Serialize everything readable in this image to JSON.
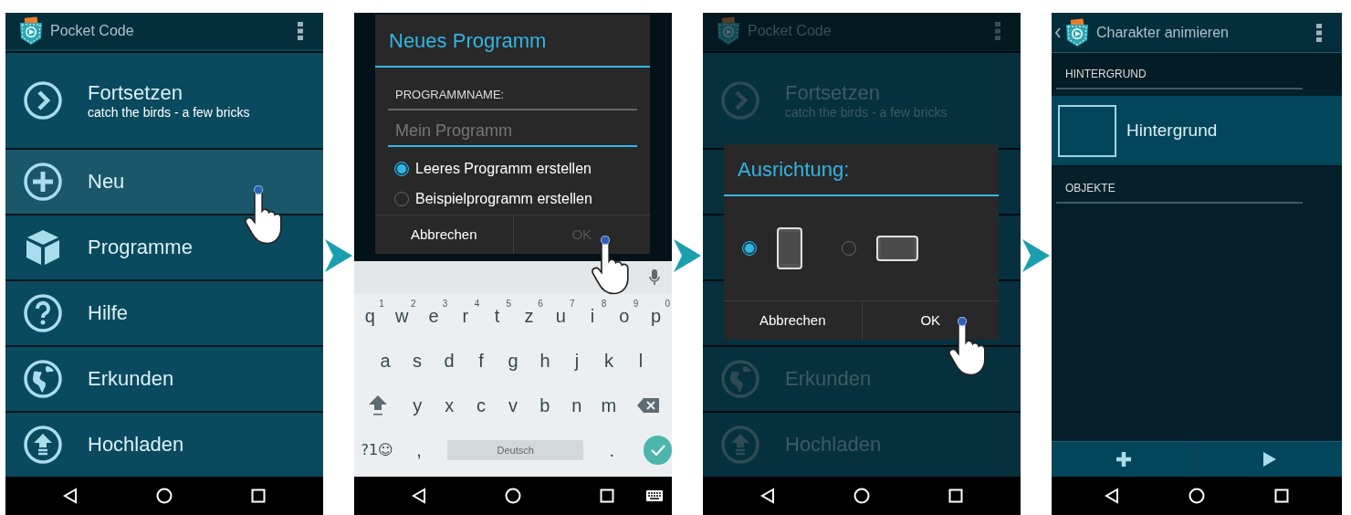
{
  "menu_screen": {
    "title": "Pocket Code",
    "items": [
      {
        "kind": "continue",
        "label": "Fortsetzen",
        "subtitle": "catch the birds - a few bricks",
        "pressed": false
      },
      {
        "kind": "new",
        "label": "Neu",
        "pressed": true
      },
      {
        "kind": "programs",
        "label": "Programme",
        "pressed": false
      },
      {
        "kind": "help",
        "label": "Hilfe",
        "pressed": false
      },
      {
        "kind": "explore",
        "label": "Erkunden",
        "pressed": false
      },
      {
        "kind": "upload",
        "label": "Hochladen",
        "pressed": false
      }
    ]
  },
  "new_program_dialog": {
    "title": "Neues Programm",
    "field_label": "PROGRAMMNAME:",
    "name_field": {
      "placeholder": "Mein Programm"
    },
    "options": [
      {
        "label": "Leeres Programm erstellen",
        "selected": true
      },
      {
        "label": "Beispielprogramm erstellen",
        "selected": false
      }
    ],
    "buttons": [
      {
        "label": "Abbrechen",
        "disabled": false
      },
      {
        "label": "OK",
        "disabled": true
      }
    ]
  },
  "keyboard": {
    "rows": [
      {
        "keys": [
          {
            "kind": "letter",
            "label": "q",
            "hint": "1"
          },
          {
            "kind": "letter",
            "label": "w",
            "hint": "2"
          },
          {
            "kind": "letter",
            "label": "e",
            "hint": "3"
          },
          {
            "kind": "letter",
            "label": "r",
            "hint": "4"
          },
          {
            "kind": "letter",
            "label": "t",
            "hint": "5"
          },
          {
            "kind": "letter",
            "label": "z",
            "hint": "6"
          },
          {
            "kind": "letter",
            "label": "u",
            "hint": "7"
          },
          {
            "kind": "letter",
            "label": "i",
            "hint": "8"
          },
          {
            "kind": "letter",
            "label": "o",
            "hint": "9"
          },
          {
            "kind": "letter",
            "label": "p",
            "hint": "0"
          }
        ]
      },
      {
        "keys": [
          {
            "kind": "letter",
            "label": "a"
          },
          {
            "kind": "letter",
            "label": "s"
          },
          {
            "kind": "letter",
            "label": "d"
          },
          {
            "kind": "letter",
            "label": "f"
          },
          {
            "kind": "letter",
            "label": "g"
          },
          {
            "kind": "letter",
            "label": "h"
          },
          {
            "kind": "letter",
            "label": "j"
          },
          {
            "kind": "letter",
            "label": "k"
          },
          {
            "kind": "letter",
            "label": "l"
          }
        ]
      },
      {
        "keys": [
          {
            "kind": "shift"
          },
          {
            "kind": "letter",
            "label": "y"
          },
          {
            "kind": "letter",
            "label": "x"
          },
          {
            "kind": "letter",
            "label": "c"
          },
          {
            "kind": "letter",
            "label": "v"
          },
          {
            "kind": "letter",
            "label": "b"
          },
          {
            "kind": "letter",
            "label": "n"
          },
          {
            "kind": "letter",
            "label": "m"
          },
          {
            "kind": "backspace"
          }
        ]
      },
      {
        "keys": [
          {
            "kind": "symbols",
            "label": "?1☺"
          },
          {
            "kind": "letter",
            "label": ","
          },
          {
            "kind": "space",
            "label": "Deutsch"
          },
          {
            "kind": "letter",
            "label": "."
          },
          {
            "kind": "enter"
          }
        ]
      }
    ]
  },
  "orientation_screen": {
    "title": "Pocket Code",
    "background_items": [
      {
        "kind": "continue",
        "label": "Fortsetzen",
        "subtitle": "catch the birds - a few bricks"
      },
      {
        "kind": "explore",
        "label": "Erkunden"
      },
      {
        "kind": "upload",
        "label": "Hochladen"
      }
    ],
    "dialog": {
      "title": "Ausrichtung:",
      "options": [
        {
          "kind": "portrait",
          "selected": true
        },
        {
          "kind": "landscape",
          "selected": false
        }
      ],
      "buttons": [
        {
          "label": "Abbrechen",
          "disabled": false
        },
        {
          "label": "OK",
          "disabled": false
        }
      ]
    }
  },
  "project_screen": {
    "title": "Charakter animieren",
    "sections": [
      {
        "heading": "HINTERGRUND",
        "items": [
          {
            "label": "Hintergrund"
          }
        ]
      },
      {
        "heading": "OBJEKTE"
      }
    ]
  }
}
